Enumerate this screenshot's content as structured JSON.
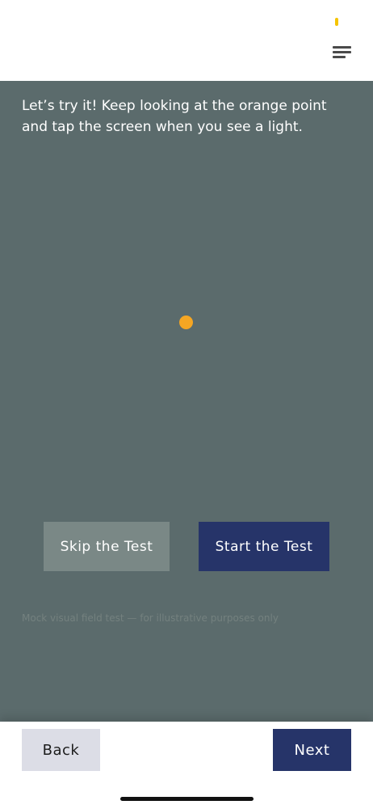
{
  "header": {
    "menu_icon": "hamburger-menu-icon",
    "accent_color": "#f5c400"
  },
  "test": {
    "instruction": "Let’s try it! Keep looking at the orange point and tap the screen when you see a light.",
    "background_color": "#5b6b6c",
    "fixation_color": "#f5a623",
    "skip_label": "Skip the Test",
    "start_label": "Start the Test",
    "disclaimer": "Mock visual field test — for illustrative purposes only"
  },
  "footer": {
    "back_label": "Back",
    "next_label": "Next",
    "primary_color": "#263469"
  }
}
